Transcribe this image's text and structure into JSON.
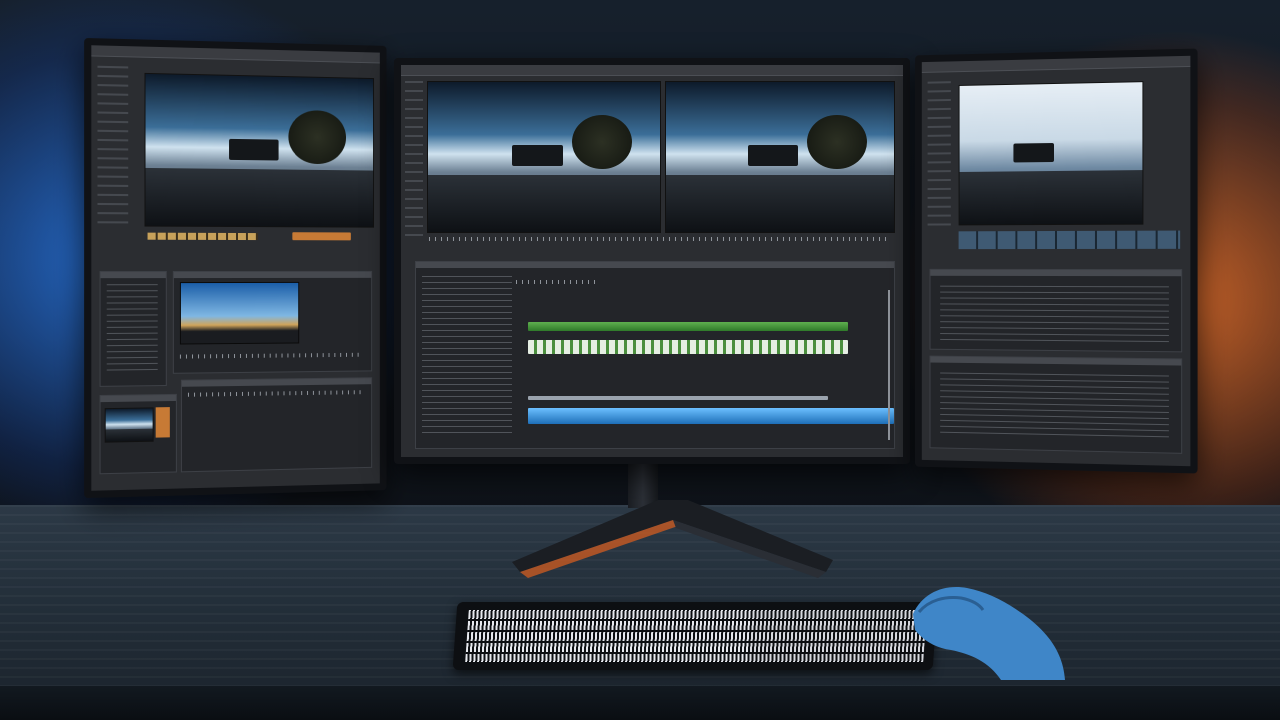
{
  "scene": {
    "description_keys": [
      "left-monitor",
      "center-monitor",
      "right-monitor",
      "desk",
      "keyboard",
      "hand"
    ],
    "backlight_left_color": "#2a7be0",
    "backlight_right_color": "#e06a28",
    "timeline_colors": {
      "video_track": "#4f9e3f",
      "audio_track": "#2e86d6",
      "highlight_clip": "#c77a35"
    }
  },
  "icons": [
    "monitor-icon",
    "keyboard-icon",
    "hand-icon"
  ]
}
